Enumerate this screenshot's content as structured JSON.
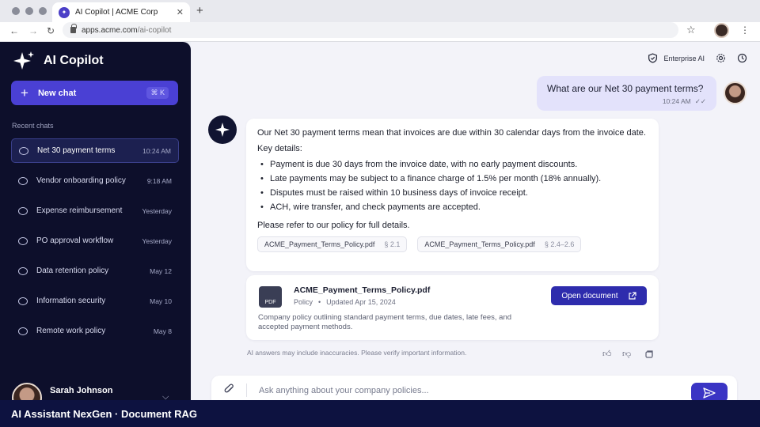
{
  "browser": {
    "tab_title": "AI Copilot | ACME Corp",
    "url_host": "apps.acme.com",
    "url_path": "/ai-copilot"
  },
  "sidebar": {
    "app_name": "AI Copilot",
    "new_chat_label": "New chat",
    "new_chat_shortcut": "⌘ K",
    "recent_heading": "Recent chats",
    "chats": [
      {
        "title": "Net 30 payment terms",
        "time": "10:24 AM",
        "active": true
      },
      {
        "title": "Vendor onboarding policy",
        "time": "9:18 AM"
      },
      {
        "title": "Expense reimbursement",
        "time": "Yesterday"
      },
      {
        "title": "PO approval workflow",
        "time": "Yesterday"
      },
      {
        "title": "Data retention policy",
        "time": "May 12"
      },
      {
        "title": "Information security",
        "time": "May 10"
      },
      {
        "title": "Remote work policy",
        "time": "May 8"
      }
    ],
    "user_name": "Sarah Johnson"
  },
  "topbar": {
    "enterprise_label": "Enterprise AI"
  },
  "conversation": {
    "user_question": "What are our Net 30 payment terms?",
    "user_time": "10:24 AM",
    "answer_intro": "Our Net 30 payment terms mean that invoices are due within 30 calendar days from the invoice date.",
    "key_details_heading": "Key details:",
    "bullets": [
      "Payment is due 30 days from the invoice date, with no early payment discounts.",
      "Late payments may be subject to a finance charge of 1.5% per month (18% annually).",
      "Disputes must be raised within 10 business days of invoice receipt.",
      "ACH, wire transfer, and check payments are accepted."
    ],
    "answer_outro": "Please refer to our policy for full details.",
    "citations": [
      {
        "file": "ACME_Payment_Terms_Policy.pdf",
        "section": "§ 2.1"
      },
      {
        "file": "ACME_Payment_Terms_Policy.pdf",
        "section": "§ 2.4–2.6"
      }
    ]
  },
  "document": {
    "icon_label": "PDF",
    "name": "ACME_Payment_Terms_Policy.pdf",
    "type": "Policy",
    "separator": "•",
    "updated": "Updated Apr 15, 2024",
    "description": "Company policy outlining standard payment terms, due dates, late fees, and accepted payment methods.",
    "open_label": "Open document"
  },
  "disclaimer": "AI answers may include inaccuracies. Please verify important information.",
  "composer": {
    "placeholder": "Ask anything about your company policies..."
  },
  "footer": {
    "caption": "AI Assistant NexGen · Document RAG"
  },
  "colors": {
    "sidebar_bg": "#0d0f2b",
    "accent": "#4a40d4",
    "primary_button": "#2e2cad",
    "user_bubble": "#e3e2fb",
    "footer_bg": "#0d1240"
  }
}
